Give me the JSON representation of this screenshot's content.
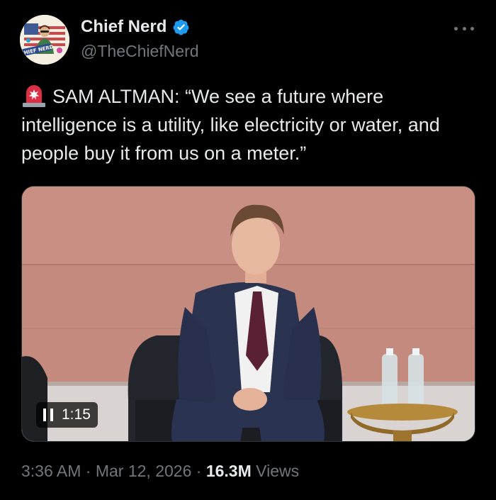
{
  "author": {
    "display_name": "Chief Nerd",
    "handle": "@TheChiefNerd",
    "verified": true,
    "avatar_text": "CHIEF NERD"
  },
  "tweet": {
    "text": "SAM ALTMAN: “We see a future where intelligence is a utility, like electricity or water, and people buy it from us on a meter.”",
    "leading_emoji": "rotating-light-icon"
  },
  "media": {
    "type": "video",
    "duration": "1:15",
    "state": "playing"
  },
  "meta": {
    "time": "3:36 AM",
    "separator": "·",
    "date": "Mar 12, 2026",
    "views_count": "16.3M",
    "views_label": "Views"
  },
  "colors": {
    "background": "#000000",
    "text": "#e7e9ea",
    "secondary_text": "#71767b",
    "verified_badge": "#1d9bf0"
  }
}
